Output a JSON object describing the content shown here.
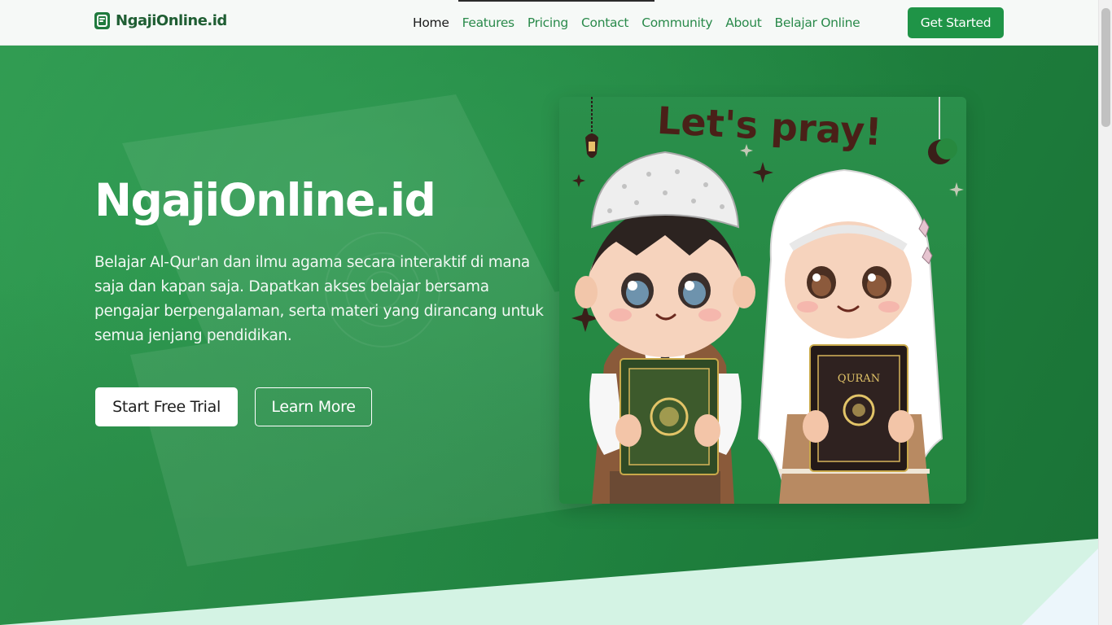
{
  "navbar": {
    "brand": "NgajiOnline.id",
    "links": [
      {
        "label": "Home",
        "active": true
      },
      {
        "label": "Features"
      },
      {
        "label": "Pricing"
      },
      {
        "label": "Contact"
      },
      {
        "label": "Community"
      },
      {
        "label": "About"
      },
      {
        "label": "Belajar Online"
      }
    ],
    "cta_label": "Get Started"
  },
  "hero": {
    "title": "NgajiOnline.id",
    "description": "Belajar Al-Qur'an dan ilmu agama secara interaktif di mana saja dan kapan saja. Dapatkan akses belajar bersama pengajar berpengalaman, serta materi yang dirancang untuk semua jenjang pendidikan.",
    "primary_button": "Start Free Trial",
    "secondary_button": "Learn More",
    "illustration": {
      "heading": "Let's pray!",
      "book_label": "QURAN"
    }
  },
  "colors": {
    "brand_green": "#1f9447",
    "hero_green": "#238b45",
    "wave_mint": "#d4f3e4"
  }
}
